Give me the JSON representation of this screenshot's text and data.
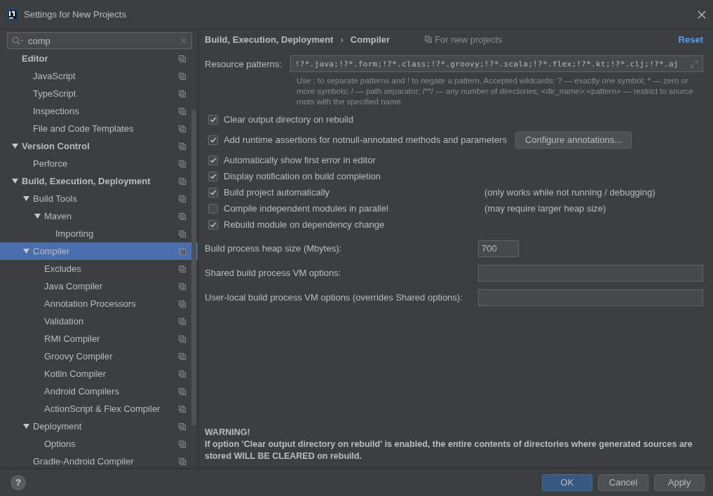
{
  "window": {
    "title": "Settings for New Projects"
  },
  "search": {
    "value": "comp"
  },
  "sidebar": {
    "items": [
      {
        "label": "Editor",
        "selected": false,
        "children": [
          {
            "label": "JavaScript",
            "selected": false
          },
          {
            "label": "TypeScript",
            "selected": false
          },
          {
            "label": "Inspections",
            "selected": false
          },
          {
            "label": "File and Code Templates",
            "selected": false
          }
        ]
      },
      {
        "label": "Version Control",
        "selected": false,
        "expanded": true,
        "children": [
          {
            "label": "Perforce",
            "selected": false
          }
        ]
      },
      {
        "label": "Build, Execution, Deployment",
        "selected": false,
        "expanded": true,
        "children": [
          {
            "label": "Build Tools",
            "selected": false,
            "expanded": true,
            "children": [
              {
                "label": "Maven",
                "selected": false,
                "expanded": true,
                "children": [
                  {
                    "label": "Importing",
                    "selected": false
                  }
                ]
              }
            ]
          },
          {
            "label": "Compiler",
            "selected": true,
            "expanded": true,
            "children": [
              {
                "label": "Excludes",
                "selected": false
              },
              {
                "label": "Java Compiler",
                "selected": false
              },
              {
                "label": "Annotation Processors",
                "selected": false
              },
              {
                "label": "Validation",
                "selected": false
              },
              {
                "label": "RMI Compiler",
                "selected": false
              },
              {
                "label": "Groovy Compiler",
                "selected": false
              },
              {
                "label": "Kotlin Compiler",
                "selected": false
              },
              {
                "label": "Android Compilers",
                "selected": false
              },
              {
                "label": "ActionScript & Flex Compiler",
                "selected": false
              }
            ]
          },
          {
            "label": "Deployment",
            "selected": false,
            "expanded": true,
            "children": [
              {
                "label": "Options",
                "selected": false
              }
            ]
          },
          {
            "label": "Gradle-Android Compiler",
            "selected": false
          }
        ]
      }
    ]
  },
  "breadcrumb": [
    "Build, Execution, Deployment",
    "Compiler"
  ],
  "breadcrumb_separator": "›",
  "scope_note": "For new projects",
  "reset": "Reset",
  "resource_patterns": {
    "label": "Resource patterns:",
    "value": "!?*.java;!?*.form;!?*.class;!?*.groovy;!?*.scala;!?*.flex;!?*.kt;!?*.clj;!?*.aj",
    "hint": "Use ; to separate patterns and ! to negate a pattern. Accepted wildcards: ? — exactly one symbol; * — zero or more symbols; / — path separator; /**/ — any number of directories; <dir_name>:<pattern> — restrict to source roots with the specified name"
  },
  "options": [
    {
      "label": "Clear output directory on rebuild",
      "checked": true
    },
    {
      "label": "Add runtime assertions for notnull-annotated methods and parameters",
      "checked": true,
      "button": "Configure annotations..."
    },
    {
      "label": "Automatically show first error in editor",
      "checked": true
    },
    {
      "label": "Display notification on build completion",
      "checked": true
    },
    {
      "label": "Build project automatically",
      "checked": true,
      "note": "(only works while not running / debugging)"
    },
    {
      "label": "Compile independent modules in parallel",
      "checked": false,
      "note": "(may require larger heap size)"
    },
    {
      "label": "Rebuild module on dependency change",
      "checked": true
    }
  ],
  "fields": [
    {
      "label": "Build process heap size (Mbytes):",
      "value": "700",
      "kind": "short"
    },
    {
      "label": "Shared build process VM options:",
      "kind": "wide"
    },
    {
      "label": "User-local build process VM options (overrides Shared options):",
      "kind": "wide"
    }
  ],
  "warning": {
    "title": "WARNING!",
    "text": "If option 'Clear output directory on rebuild' is enabled, the entire contents of directories where generated sources are stored WILL BE CLEARED on rebuild."
  },
  "footer": {
    "help": "?",
    "buttons": [
      {
        "label": "OK",
        "primary": true
      },
      {
        "label": "Cancel",
        "primary": false
      },
      {
        "label": "Apply",
        "primary": false
      }
    ]
  }
}
